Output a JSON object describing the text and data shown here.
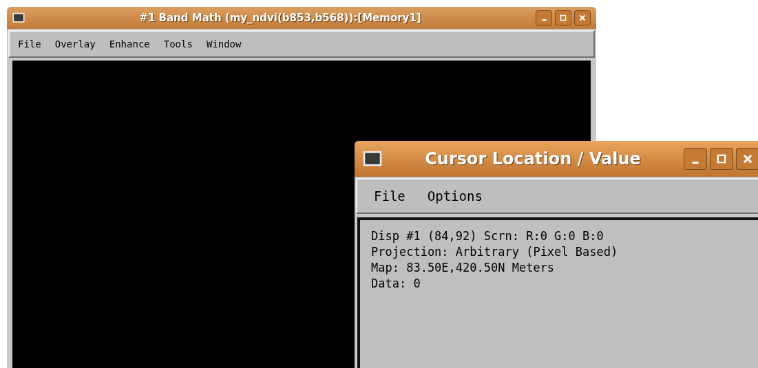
{
  "windows": [
    {
      "title": "#1 Band Math (my_ndvi(b853,b568)):[Memory1]",
      "kind": "display",
      "active": false,
      "menu": [
        "File",
        "Overlay",
        "Enhance",
        "Tools",
        "Window"
      ]
    },
    {
      "title": "Cursor Location / Value",
      "kind": "text",
      "active": true,
      "menu": [
        "File",
        "Options"
      ],
      "lines": [
        "Disp #1 (84,92) Scrn: R:0 G:0 B:0",
        "Projection: Arbitrary (Pixel Based)",
        "Map: 83.50E,420.50N Meters",
        "Data: 0"
      ]
    }
  ]
}
